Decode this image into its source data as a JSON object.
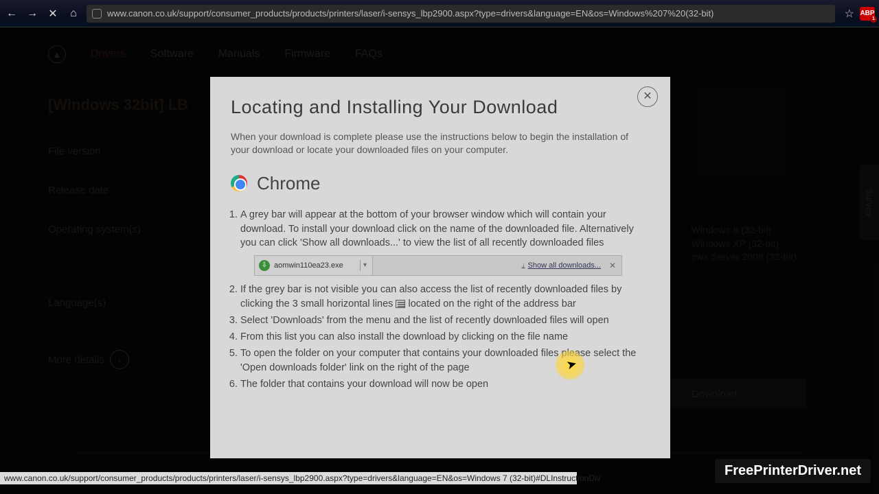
{
  "browser": {
    "url": "www.canon.co.uk/support/consumer_products/products/printers/laser/i-sensys_lbp2900.aspx?type=drivers&language=EN&os=Windows%207%20(32-bit)",
    "abp_label": "ABP",
    "abp_count": "1"
  },
  "background": {
    "tabs": [
      "Drivers",
      "Software",
      "Manuals",
      "Firmware",
      "FAQs"
    ],
    "active_tab_index": 0,
    "heading_prefix": "[Windows 32bit] LB",
    "rows": {
      "file_version_label": "File version",
      "release_date_label": "Release date",
      "os_label": "Operating system(s)",
      "languages_label": "Language(s)"
    },
    "os_values_right": [
      "Windows 8 (32-bit)",
      "Windows XP (32-bit)",
      "ows Server 2008 (32-bit)"
    ],
    "more_details": "More details",
    "download_btn": "Download",
    "survey": "Survey"
  },
  "modal": {
    "title": "Locating and Installing Your Download",
    "intro": "When your download is complete please use the instructions below to begin the installation of your download or locate your downloaded files on your computer.",
    "chrome_label": "Chrome",
    "steps": {
      "s1": "A grey bar will appear at the bottom of your browser window which will contain your download. To install your download click on the name of the downloaded file. Alternatively you can click 'Show all downloads...' to view the list of all recently downloaded files",
      "s2a": "If the grey bar is not visible you can also access the list of recently downloaded files by clicking the 3 small horizontal lines ",
      "s2b": " located on the right of the address bar",
      "s3": "Select 'Downloads' from the menu and the list of recently downloaded files will open",
      "s4": "From this list you can also install the download by clicking on the file name",
      "s5": "To open the folder on your computer that contains your downloaded files please select the 'Open downloads folder' link on the right of the page",
      "s6": "The folder that contains your download will now be open"
    },
    "download_bar": {
      "filename": "aomwin110ea23.exe",
      "show_all": "Show all downloads..."
    }
  },
  "status_url": "www.canon.co.uk/support/consumer_products/products/printers/laser/i-sensys_lbp2900.aspx?type=drivers&language=EN&os=Windows 7 (32-bit)#DLInstructionDiv",
  "watermark": "FreePrinterDriver.net"
}
